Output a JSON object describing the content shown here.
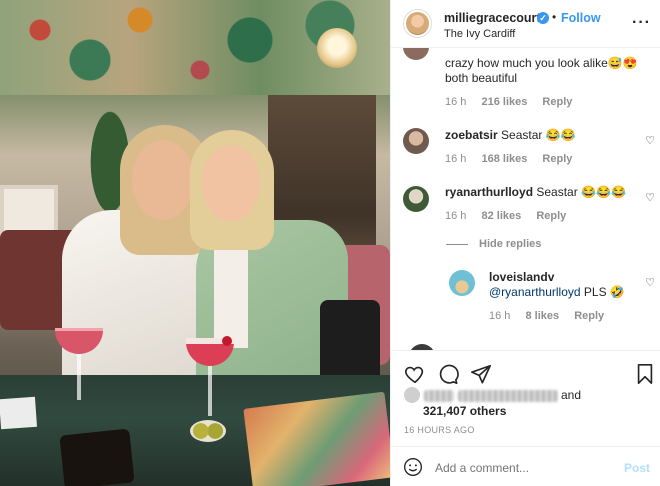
{
  "post": {
    "username": "milliegracecourt",
    "verified": true,
    "dot": "•",
    "follow_label": "Follow",
    "location": "The Ivy Cardiff",
    "more_icon": "ellipsis-icon"
  },
  "comments": [
    {
      "username": "",
      "text": "crazy how much you look alike😅😍 both beautiful",
      "time": "16 h",
      "likes": "216 likes",
      "reply": "Reply"
    },
    {
      "username": "zoebatsir",
      "text": "Seastar 😂😂",
      "time": "16 h",
      "likes": "168 likes",
      "reply": "Reply"
    },
    {
      "username": "ryanarthurlloyd",
      "text": "Seastar 😂😂😂",
      "time": "16 h",
      "likes": "82 likes",
      "reply": "Reply"
    }
  ],
  "hide_replies": "Hide replies",
  "reply": {
    "username": "loveislandv",
    "mention": "@ryanarthurlloyd",
    "text": " PLS 🤣",
    "time": "16 h",
    "likes": "8 likes",
    "reply": "Reply"
  },
  "likes_summary": {
    "and": "and",
    "others": "321,407 others"
  },
  "timestamp": "16 HOURS AGO",
  "add_comment": {
    "placeholder": "Add a comment...",
    "post_label": "Post"
  }
}
